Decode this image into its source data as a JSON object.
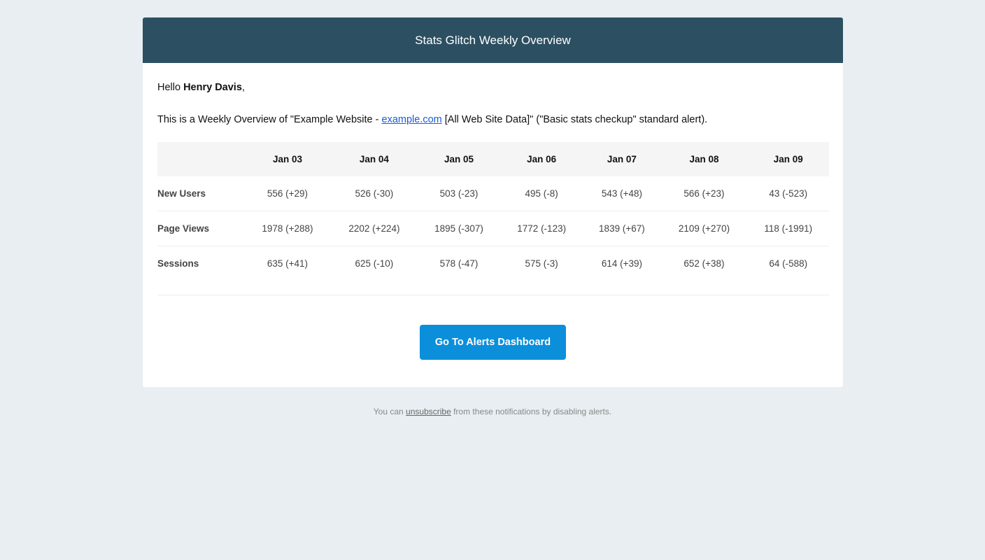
{
  "header": {
    "title": "Stats Glitch Weekly Overview"
  },
  "greeting": {
    "prefix": "Hello ",
    "name": "Henry Davis",
    "suffix": ","
  },
  "intro": {
    "before_link": "This is a Weekly Overview of \"Example Website - ",
    "link_text": "example.com",
    "after_link": " [All Web Site Data]\" (\"Basic stats checkup\" standard alert)."
  },
  "table": {
    "columns": [
      "Jan 03",
      "Jan 04",
      "Jan 05",
      "Jan 06",
      "Jan 07",
      "Jan 08",
      "Jan 09"
    ],
    "rows": [
      {
        "label": "New Users",
        "values": [
          "556 (+29)",
          "526 (-30)",
          "503 (-23)",
          "495 (-8)",
          "543 (+48)",
          "566 (+23)",
          "43 (-523)"
        ]
      },
      {
        "label": "Page Views",
        "values": [
          "1978 (+288)",
          "2202 (+224)",
          "1895 (-307)",
          "1772 (-123)",
          "1839 (+67)",
          "2109 (+270)",
          "118 (-1991)"
        ]
      },
      {
        "label": "Sessions",
        "values": [
          "635 (+41)",
          "625 (-10)",
          "578 (-47)",
          "575 (-3)",
          "614 (+39)",
          "652 (+38)",
          "64 (-588)"
        ]
      }
    ]
  },
  "cta": {
    "label": "Go To Alerts Dashboard"
  },
  "footer": {
    "before_link": "You can ",
    "link_text": "unsubscribe",
    "after_link": " from these notifications by disabling alerts."
  },
  "colors": {
    "header_bg": "#2c5062",
    "button_bg": "#0b8fdb",
    "page_bg": "#e8eef2",
    "link": "#1a5bd6"
  }
}
